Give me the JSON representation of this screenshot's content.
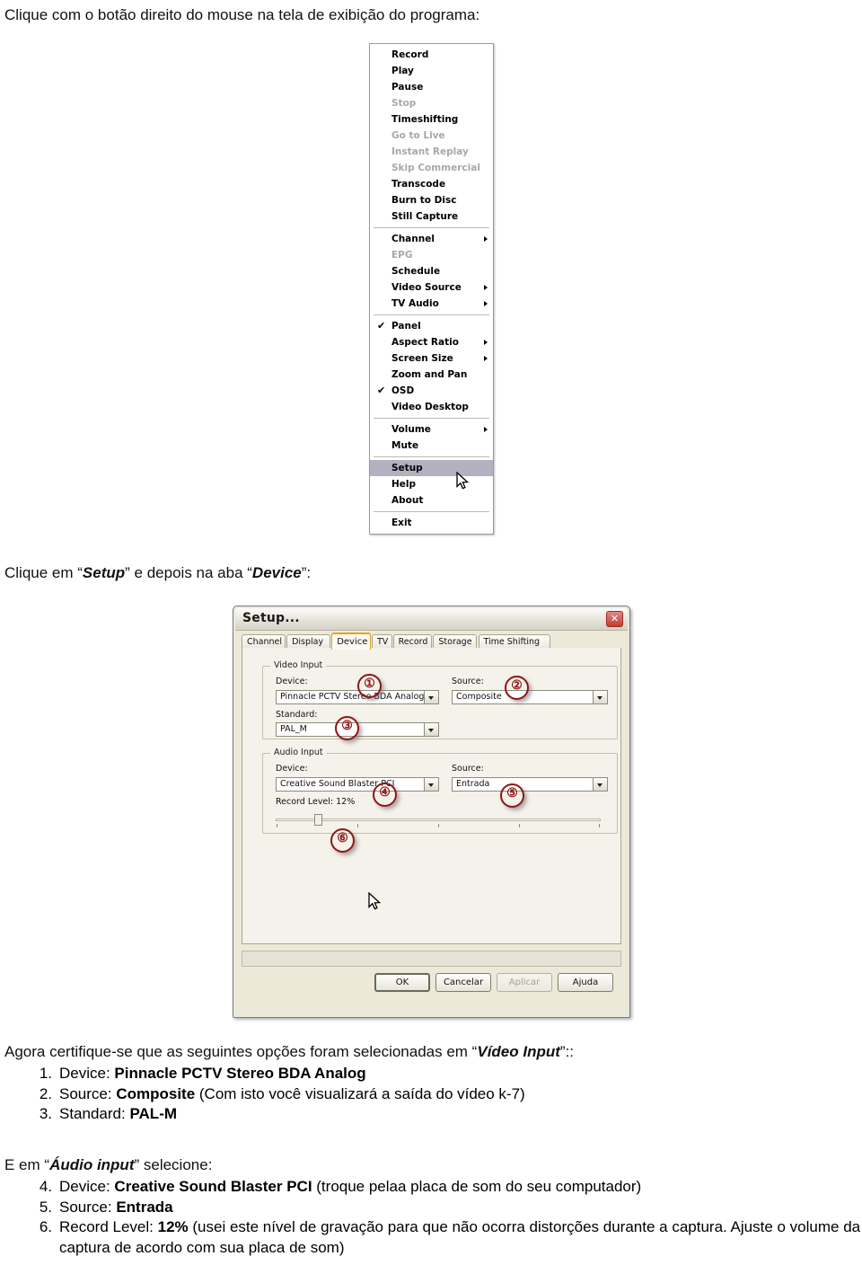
{
  "document": {
    "intro_line": "Clique com o botão direito do mouse na tela de exibição do programa:",
    "setup_line_pre": "Clique em “",
    "setup_line_bold1": "Setup",
    "setup_line_mid": "” e depois na aba “",
    "setup_line_bold2": "Device",
    "setup_line_post": "”:",
    "video_intro_pre": "Agora certifique-se que as seguintes opções foram selecionadas em “",
    "video_intro_bold": "Vídeo Input",
    "video_intro_post": "”::",
    "audio_intro_pre": "E em “",
    "audio_intro_bold": "Áudio input",
    "audio_intro_post": "” selecione:",
    "video_items": [
      {
        "num": "1.",
        "label": "Device: ",
        "value": "Pinnacle PCTV Stereo BDA Analog",
        "note": ""
      },
      {
        "num": "2.",
        "label": "Source: ",
        "value": "Composite",
        "note": " (Com isto você visualizará a saída do vídeo k-7)"
      },
      {
        "num": "3.",
        "label": "Standard: ",
        "value": "PAL-M",
        "note": ""
      }
    ],
    "audio_items": [
      {
        "num": "4.",
        "label": "Device: ",
        "value": "Creative Sound Blaster PCI",
        "note": " (troque pelaa placa de som do seu computador)"
      },
      {
        "num": "5.",
        "label": "Source: ",
        "value": "Entrada",
        "note": ""
      },
      {
        "num": "6.",
        "label": "Record Level: ",
        "value": "12%",
        "note": " (usei este nível de gravação para que não ocorra distorções durante a captura. Ajuste o volume da captura de acordo com sua placa de som)"
      }
    ]
  },
  "context_menu": {
    "items": [
      {
        "label": "Record",
        "state": "enabled",
        "submenu": false,
        "checked": false
      },
      {
        "label": "Play",
        "state": "enabled",
        "submenu": false,
        "checked": false
      },
      {
        "label": "Pause",
        "state": "enabled",
        "submenu": false,
        "checked": false
      },
      {
        "label": "Stop",
        "state": "disabled",
        "submenu": false,
        "checked": false
      },
      {
        "label": "Timeshifting",
        "state": "enabled",
        "submenu": false,
        "checked": false
      },
      {
        "label": "Go to Live",
        "state": "disabled",
        "submenu": false,
        "checked": false
      },
      {
        "label": "Instant Replay",
        "state": "disabled",
        "submenu": false,
        "checked": false
      },
      {
        "label": "Skip Commercial",
        "state": "disabled",
        "submenu": false,
        "checked": false
      },
      {
        "label": "Transcode",
        "state": "enabled",
        "submenu": false,
        "checked": false
      },
      {
        "label": "Burn to Disc",
        "state": "enabled",
        "submenu": false,
        "checked": false
      },
      {
        "label": "Still Capture",
        "state": "enabled",
        "submenu": false,
        "checked": false
      },
      {
        "separator": true
      },
      {
        "label": "Channel",
        "state": "enabled",
        "submenu": true,
        "checked": false
      },
      {
        "label": "EPG",
        "state": "disabled",
        "submenu": false,
        "checked": false
      },
      {
        "label": "Schedule",
        "state": "enabled",
        "submenu": false,
        "checked": false
      },
      {
        "label": "Video Source",
        "state": "enabled",
        "submenu": true,
        "checked": false
      },
      {
        "label": "TV Audio",
        "state": "enabled",
        "submenu": true,
        "checked": false
      },
      {
        "separator": true
      },
      {
        "label": "Panel",
        "state": "enabled",
        "submenu": false,
        "checked": true
      },
      {
        "label": "Aspect Ratio",
        "state": "enabled",
        "submenu": true,
        "checked": false
      },
      {
        "label": "Screen Size",
        "state": "enabled",
        "submenu": true,
        "checked": false
      },
      {
        "label": "Zoom and Pan",
        "state": "enabled",
        "submenu": false,
        "checked": false
      },
      {
        "label": "OSD",
        "state": "enabled",
        "submenu": false,
        "checked": true
      },
      {
        "label": "Video Desktop",
        "state": "enabled",
        "submenu": false,
        "checked": false
      },
      {
        "separator": true
      },
      {
        "label": "Volume",
        "state": "enabled",
        "submenu": true,
        "checked": false
      },
      {
        "label": "Mute",
        "state": "enabled",
        "submenu": false,
        "checked": false
      },
      {
        "separator": true
      },
      {
        "label": "Setup",
        "state": "selected",
        "submenu": false,
        "checked": false
      },
      {
        "label": "Help",
        "state": "enabled",
        "submenu": false,
        "checked": false
      },
      {
        "label": "About",
        "state": "enabled",
        "submenu": false,
        "checked": false
      },
      {
        "separator": true
      },
      {
        "label": "Exit",
        "state": "enabled",
        "submenu": false,
        "checked": false
      }
    ],
    "check_glyph": "✔",
    "selected_bg": "#b4b0c0"
  },
  "dialog": {
    "title": "Setup...",
    "close_label": "✕",
    "tabs": [
      {
        "label": "Channel",
        "active": false
      },
      {
        "label": "Display",
        "active": false
      },
      {
        "label": "Device",
        "active": true
      },
      {
        "label": "TV",
        "active": false
      },
      {
        "label": "Record",
        "active": false
      },
      {
        "label": "Storage",
        "active": false
      },
      {
        "label": "Time Shifting",
        "active": false
      }
    ],
    "active_tab_accent": "#e8a317",
    "video_input": {
      "group_label": "Video Input",
      "device_label": "Device:",
      "device_value": "Pinnacle PCTV Stereo BDA Analog",
      "source_label": "Source:",
      "source_value": "Composite",
      "standard_label": "Standard:",
      "standard_value": "PAL_M"
    },
    "audio_input": {
      "group_label": "Audio Input",
      "device_label": "Device:",
      "device_value": "Creative Sound Blaster PCI",
      "source_label": "Source:",
      "source_value": "Entrada",
      "record_level_label": "Record Level: 12%",
      "record_level_percent": 12
    },
    "buttons": [
      {
        "label": "OK",
        "style": "default"
      },
      {
        "label": "Cancelar",
        "style": "normal"
      },
      {
        "label": "Aplicar",
        "style": "disabled"
      },
      {
        "label": "Ajuda",
        "style": "normal"
      }
    ]
  },
  "callouts": [
    {
      "number": "①",
      "target": "video-device"
    },
    {
      "number": "②",
      "target": "video-source"
    },
    {
      "number": "③",
      "target": "video-standard"
    },
    {
      "number": "④",
      "target": "audio-device"
    },
    {
      "number": "⑤",
      "target": "audio-source"
    },
    {
      "number": "⑥",
      "target": "record-level-slider"
    }
  ],
  "callout_color": "#8d1515"
}
